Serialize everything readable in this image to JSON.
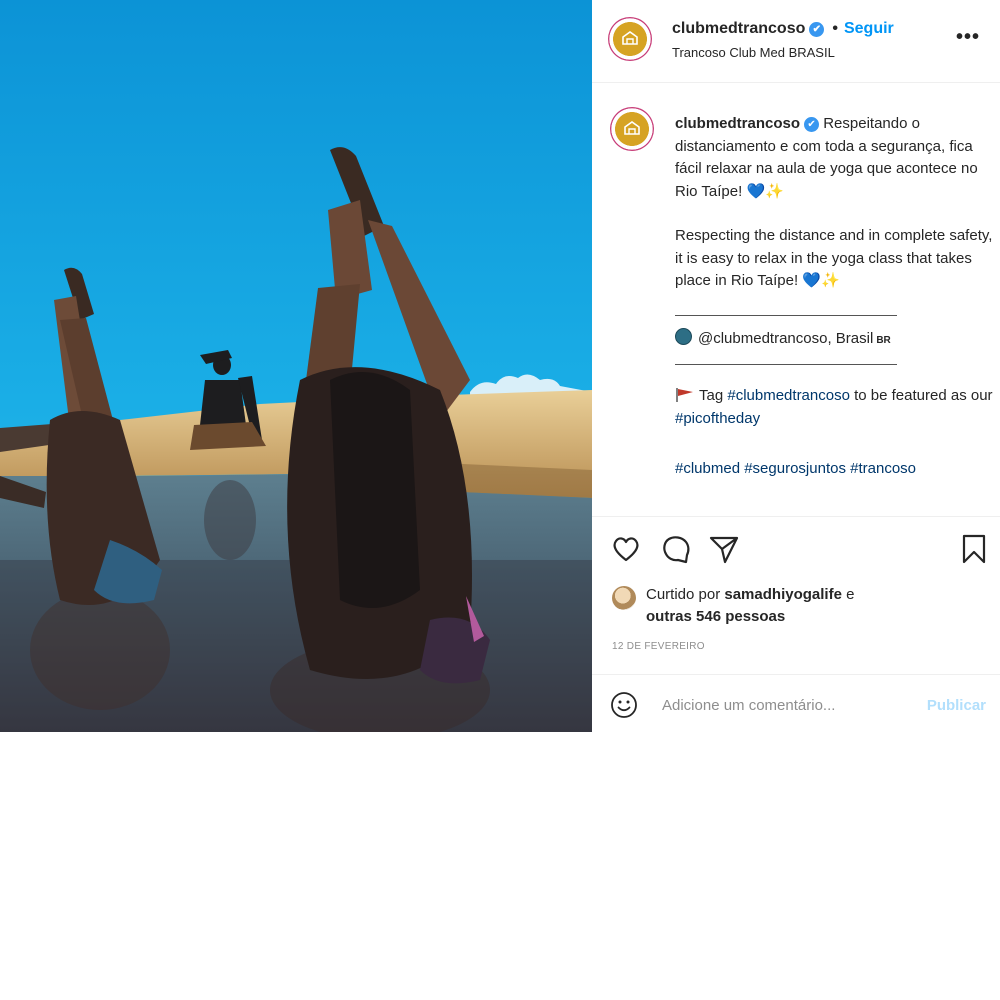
{
  "post": {
    "username": "clubmedtrancoso",
    "verified_mark": "✔",
    "separator": "•",
    "follow_label": "Seguir",
    "location": "Trancoso Club Med BRASIL",
    "more_label": "•••"
  },
  "caption": {
    "username": "clubmedtrancoso",
    "text_pt": "Respeitando o distanciamento e com toda a segurança, fica fácil relaxar na aula de yoga que acontece no Rio Taípe!",
    "text_en": "Respecting the distance and in complete safety, it is easy to relax in the yoga class that takes place in Rio Taípe!",
    "emoji_heart": "💙",
    "emoji_sparkle": "✨",
    "mention_line": "@clubmedtrancoso, Brasil",
    "mention_flag": "BR",
    "tag_prefix": "Tag",
    "tag_handle": "#clubmedtrancoso",
    "tag_middle": "to be featured as our",
    "tag_hashtag": "#picoftheday",
    "hashtags": [
      "#clubmed",
      "#segurosjuntos",
      "#trancoso"
    ]
  },
  "likes": {
    "prefix": "Curtido por",
    "user": "samadhiyogalife",
    "connector": "e",
    "others": "outras 546 pessoas"
  },
  "date": "12 DE FEVEREIRO",
  "comment": {
    "placeholder": "Adicione um comentário...",
    "publish_label": "Publicar"
  },
  "icons": {
    "like": "heart-outline-icon",
    "comment": "comment-bubble-icon",
    "share": "paper-plane-icon",
    "save": "bookmark-icon",
    "emoji": "smiley-icon",
    "more": "ellipsis-icon"
  },
  "colors": {
    "link": "#0095f6",
    "hashtag": "#00376b",
    "sky": "#19a6e0",
    "avatar_gold": "#d6a323"
  }
}
